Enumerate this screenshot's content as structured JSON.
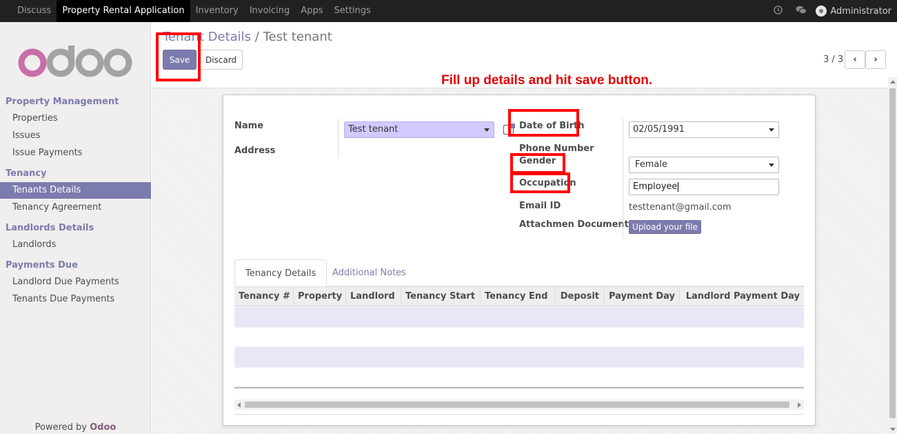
{
  "topbar": {
    "menu": [
      "Discuss",
      "Property Rental Application",
      "Inventory",
      "Invoicing",
      "Apps",
      "Settings"
    ],
    "active_index": 1,
    "user": "Administrator",
    "icons": [
      "clock-icon",
      "chat-icon"
    ]
  },
  "sidebar": {
    "logo": "odoo",
    "sections": [
      {
        "title": "Property Management",
        "items": [
          "Properties",
          "Issues",
          "Issue Payments"
        ]
      },
      {
        "title": "Tenancy",
        "items": [
          "Tenants Details",
          "Tenancy Agreement"
        ]
      },
      {
        "title": "Landlords Details",
        "items": [
          "Landlords"
        ]
      },
      {
        "title": "Payments Due",
        "items": [
          "Landlord Due Payments",
          "Tenants Due Payments"
        ]
      }
    ],
    "active_item": "Tenants Details",
    "powered_prefix": "Powered by",
    "powered_brand": "Odoo"
  },
  "breadcrumb": {
    "parent": "Tenant Details",
    "separator": "/",
    "current": "Test tenant"
  },
  "buttons": {
    "save": "Save",
    "discard": "Discard",
    "upload": "Upload your file"
  },
  "pager": {
    "text": "3 / 3",
    "prev": "‹",
    "next": "›"
  },
  "annotation": "Fill up details and hit save button.",
  "form": {
    "labels": {
      "name": "Name",
      "address": "Address",
      "dob": "Date of Birth",
      "phone": "Phone Number",
      "gender": "Gender",
      "occupation": "Occupation",
      "email": "Email ID",
      "attachment": "Attachmen Document"
    },
    "values": {
      "name": "Test tenant",
      "dob": "02/05/1991",
      "gender": "Female",
      "occupation": "Employee",
      "email": "testtenant@gmail.com"
    }
  },
  "tabs": [
    "Tenancy Details",
    "Additional Notes"
  ],
  "table": {
    "columns": [
      "Tenancy #",
      "Property",
      "Landlord",
      "Tenancy Start",
      "Tenancy End",
      "Deposit",
      "Payment Day",
      "Landlord Payment Day"
    ]
  },
  "colors": {
    "brand": "#7c7bad",
    "annotation": "#e60000",
    "highlight_box": "#ff0000"
  }
}
